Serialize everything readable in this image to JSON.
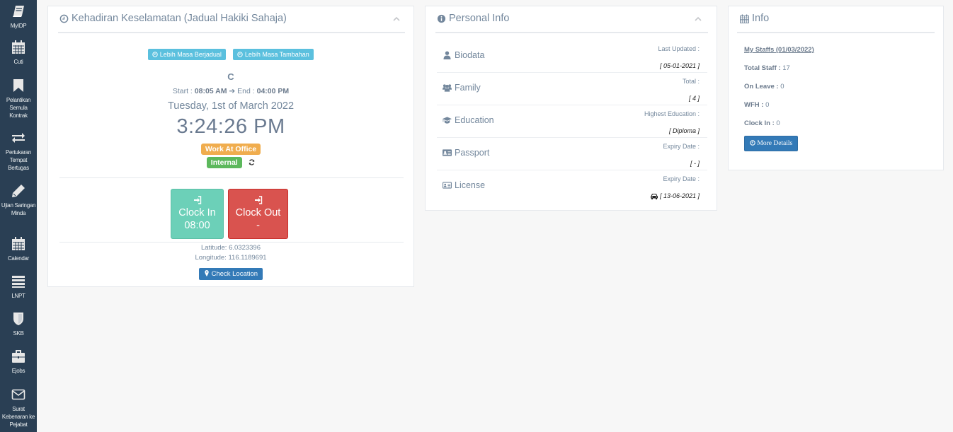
{
  "sidebar": {
    "items": [
      {
        "label": "MyIDP",
        "icon": "book-icon"
      },
      {
        "label": "Cuti",
        "icon": "calendar-icon"
      },
      {
        "label": "Pelantikan Semula Kontrak",
        "icon": "bookmark-icon"
      },
      {
        "label": "Pertukaran Tempat Bertugas",
        "icon": "exchange-icon"
      },
      {
        "label": "Ujian Saringan Minda",
        "icon": "pencil-icon"
      },
      {
        "label": "Calendar",
        "icon": "calendar-icon"
      },
      {
        "label": "LNPT",
        "icon": "list-icon"
      },
      {
        "label": "SKB",
        "icon": "shield-icon"
      },
      {
        "label": "Ejobs",
        "icon": "briefcase-icon"
      },
      {
        "label": "Surat Kebenaran ke Pejabat",
        "icon": "envelope-icon"
      }
    ]
  },
  "attendance": {
    "title": "Kehadiran Keselamatan (Jadual Hakiki Sahaja)",
    "btn_overtime_scheduled": "Lebih Masa Berjadual",
    "btn_overtime_extra": "Lebih Masa Tambahan",
    "shift_code": "C",
    "start_label": "Start :",
    "start_time": "08:05 AM",
    "end_label": "End :",
    "end_time": "04:00 PM",
    "date": "Tuesday, 1st of March 2022",
    "clock": "3:24:26 PM",
    "work_mode": "Work At Office",
    "network": "Internal",
    "clock_in_label": "Clock In",
    "clock_in_time": "08:00",
    "clock_out_label": "Clock Out",
    "clock_out_time": "-",
    "latitude": "Latitude: 6.0323396",
    "longitude": "Longitude: 116.1189691",
    "check_location": "Check Location"
  },
  "personal_info": {
    "title": "Personal Info",
    "rows": [
      {
        "name": "Biodata",
        "icon": "user-icon",
        "meta": "Last Updated :",
        "value": "[ 05-01-2021 ]"
      },
      {
        "name": "Family",
        "icon": "users-icon",
        "meta": "Total :",
        "value": "[ 4 ]"
      },
      {
        "name": "Education",
        "icon": "graduation-cap-icon",
        "meta": "Highest Education :",
        "value": "[ Diploma ]"
      },
      {
        "name": "Passport",
        "icon": "id-card-icon",
        "meta": "Expiry Date :",
        "value": "[ - ]"
      },
      {
        "name": "License",
        "icon": "id-card-outline-icon",
        "meta": "Expiry Date :",
        "value": "[ 13-06-2021 ]"
      }
    ]
  },
  "info": {
    "title": "Info",
    "my_staffs": "My Staffs (01/03/2022)",
    "total_staff_label": "Total Staff :",
    "total_staff": "17",
    "on_leave_label": "On Leave :",
    "on_leave": "0",
    "wfh_label": "WFH :",
    "wfh": "0",
    "clock_in_label": "Clock In :",
    "clock_in": "0",
    "more_details": "More Details"
  },
  "colors": {
    "sidebar": "#2a3f54",
    "info": "#5bc0de",
    "primary": "#337ab7",
    "success": "#5cb85c",
    "warning": "#f0ad4e",
    "danger": "#d9534f",
    "clock_in": "#6cd0b8"
  }
}
